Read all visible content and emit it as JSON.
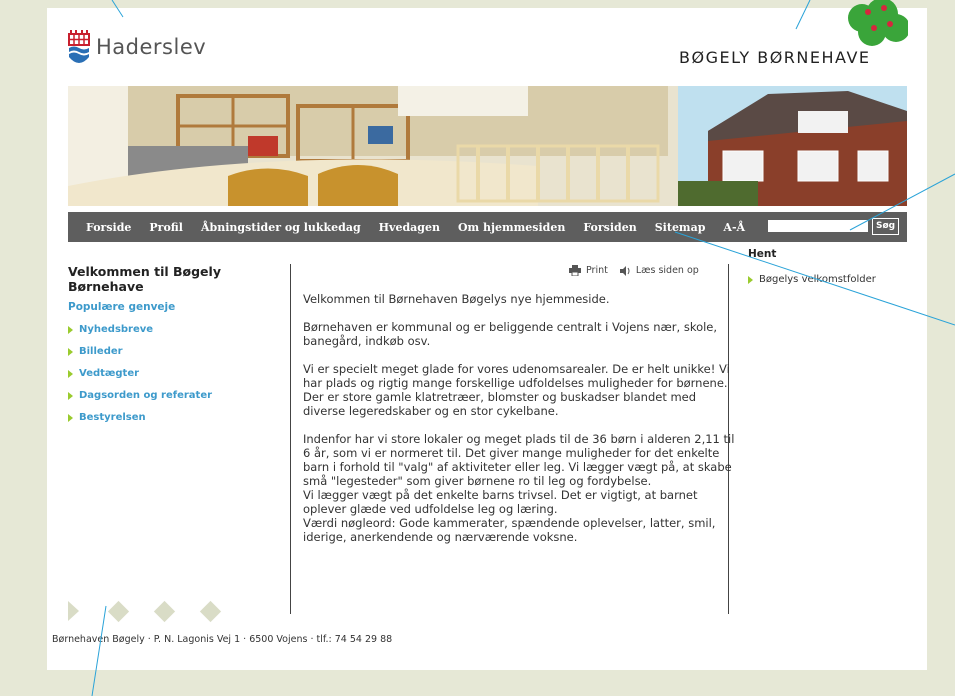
{
  "header": {
    "municipality": "Haderslev",
    "site_title": "BØGELY BØRNEHAVE"
  },
  "nav": {
    "items": [
      "Forside",
      "Profil",
      "Åbningstider og lukkedag",
      "Hvedagen",
      "Om hjemmesiden",
      "Forsiden",
      "Sitemap",
      "A-Å"
    ],
    "search_placeholder": "",
    "search_button": "Søg"
  },
  "left": {
    "heading": "Velkommen til Bøgely Børnehave",
    "subheading": "Populære genveje",
    "links": [
      "Nyhedsbreve",
      "Billeder",
      "Vedtægter",
      "Dagsorden og referater",
      "Bestyrelsen"
    ]
  },
  "tools": {
    "print": "Print",
    "read": "Læs siden op"
  },
  "main": {
    "paragraphs": [
      "Velkommen til Børnehaven Bøgelys nye hjemmeside.",
      "Børnehaven er kommunal og er beliggende centralt i Vojens nær, skole, banegård, indkøb osv.",
      "Vi er specielt meget glade for vores udenomsarealer. De er helt unikke! Vi har plads og rigtig mange forskellige udfoldelses muligheder for børnene. Der er store gamle klatretræer, blomster og buskadser blandet med diverse legeredskaber og en stor cykelbane.",
      "Indenfor har vi store lokaler og meget plads til de 36 børn i alderen 2,11 til 6 år, som vi er normeret til. Det giver mange muligheder for det enkelte barn i forhold til \"valg\" af aktiviteter eller leg. Vi lægger vægt på, at skabe små \"legesteder\" som giver børnene ro til leg og fordybelse.",
      "Vi lægger vægt på det enkelte barns trivsel. Det er vigtigt, at barnet oplever glæde ved udfoldelse leg og læring.",
      "Værdi nøgleord: Gode kammerater, spændende oplevelser, latter, smil, iderige, anerkendende og nærværende voksne."
    ]
  },
  "right": {
    "heading": "Hent",
    "link": "Bøgelys velkomstfolder"
  },
  "footer": {
    "text": "Børnehaven Bøgely · P. N. Lagonis Vej 1 · 6500 Vojens · tlf.: 74 54 29 88"
  },
  "colors": {
    "background": "#e6e8d6",
    "nav": "#5e5e5e",
    "link": "#3d9acb",
    "bullet": "#9acb2e",
    "logo_blue": "#2a6fb5",
    "logo_red": "#c8202e"
  }
}
